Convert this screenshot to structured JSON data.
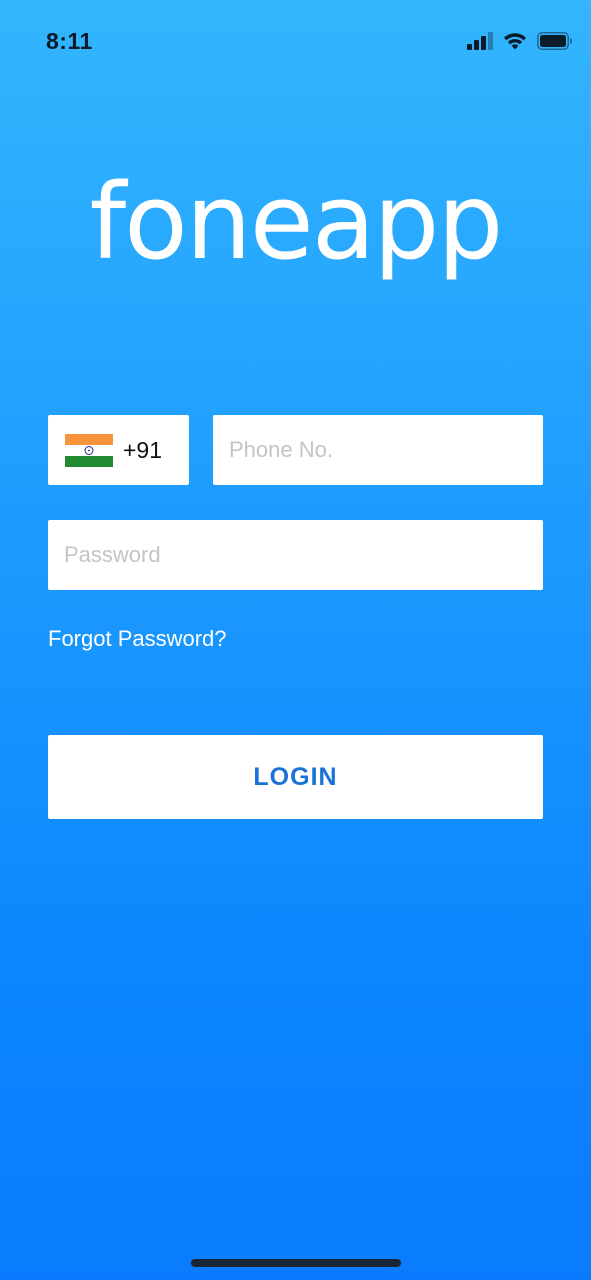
{
  "status_bar": {
    "time": "8:11",
    "icons": [
      "cellular-signal-icon",
      "wifi-icon",
      "battery-icon"
    ]
  },
  "logo": {
    "text": "foneapp"
  },
  "country": {
    "flag_icon": "india-flag-icon",
    "code": "+91"
  },
  "phone": {
    "value": "",
    "placeholder": "Phone No."
  },
  "password": {
    "value": "",
    "placeholder": "Password"
  },
  "forgot_password": {
    "label": "Forgot Password?"
  },
  "login": {
    "label": "LOGIN"
  },
  "colors": {
    "background_top": "#33b6fd",
    "background_bottom": "#0a7bfe",
    "button_text": "#1a72d9",
    "field_background": "#ffffff",
    "placeholder": "#c4c4c4"
  }
}
